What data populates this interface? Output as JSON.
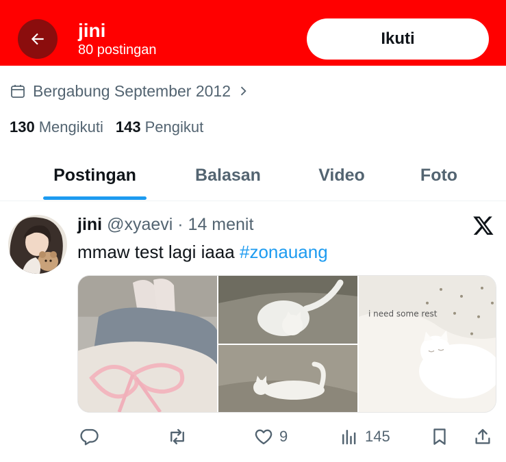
{
  "header": {
    "name": "jini",
    "post_count": "80 postingan",
    "follow_label": "Ikuti",
    "accent_color": "#ff0000"
  },
  "profile": {
    "joined": "Bergabung September 2012",
    "following_count": "130",
    "following_label": "Mengikuti",
    "followers_count": "143",
    "followers_label": "Pengikut"
  },
  "tabs": [
    {
      "label": "Postingan",
      "active": true
    },
    {
      "label": "Balasan",
      "active": false
    },
    {
      "label": "Video",
      "active": false
    },
    {
      "label": "Foto",
      "active": false
    }
  ],
  "tweet": {
    "name": "jini",
    "handle": "@xyaevi",
    "separator": "·",
    "time": "14 menit",
    "text": "mmaw test lagi iaaa ",
    "hashtag": "#zonauang",
    "photo_caption": "i need some rest",
    "actions": {
      "reply_icon": "reply-icon",
      "retweet_icon": "retweet-icon",
      "like_count": "9",
      "views_count": "145"
    }
  }
}
